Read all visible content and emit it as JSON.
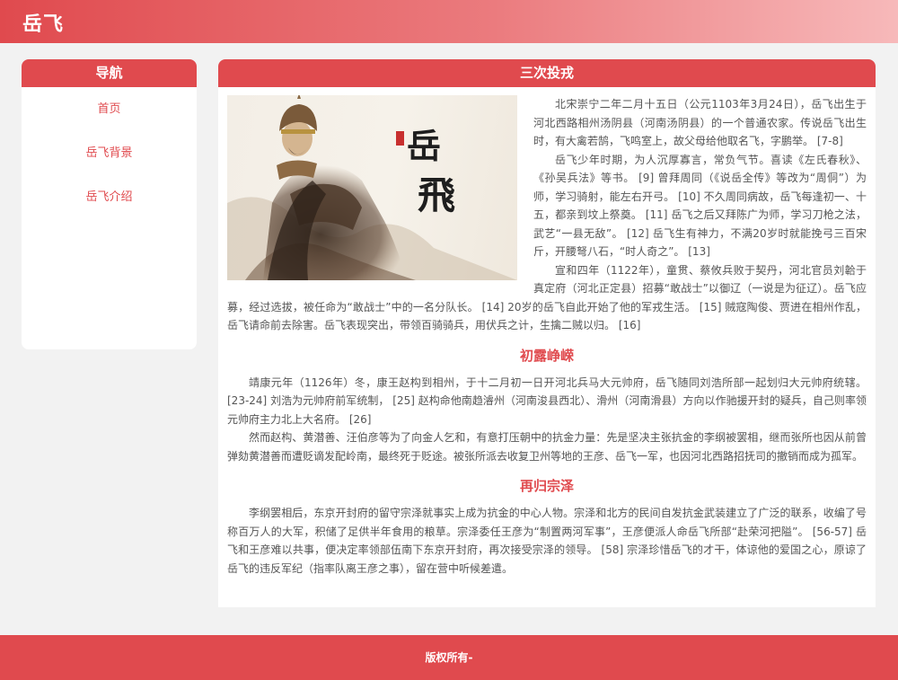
{
  "header": {
    "title": "岳飞"
  },
  "sidebar": {
    "title": "导航",
    "items": [
      {
        "label": "首页"
      },
      {
        "label": "岳飞背景"
      },
      {
        "label": "岳飞介绍"
      }
    ]
  },
  "main": {
    "title": "三次投戎",
    "image": {
      "calligraphy": "岳飛"
    },
    "intro_paragraphs": [
      "北宋崇宁二年二月十五日（公元1103年3月24日），岳飞出生于河北西路相州汤阴县（河南汤阴县）的一个普通农家。传说岳飞出生时，有大禽若鹄，飞鸣室上，故父母给他取名飞，字鹏举。 [7-8]",
      "岳飞少年时期，为人沉厚寡言，常负气节。喜读《左氏春秋》、《孙吴兵法》等书。 [9] 曾拜周同（《说岳全传》等改为“周侗”）为师，学习骑射，能左右开弓。 [10] 不久周同病故，岳飞每逢初一、十五，都亲到坟上祭奠。 [11] 岳飞之后又拜陈广为师，学习刀枪之法，武艺“一县无敌”。 [12] 岳飞生有神力，不满20岁时就能挽弓三百宋斤，开腰弩八石，“时人奇之”。 [13]",
      "宣和四年（1122年），童贯、蔡攸兵败于契丹，河北官员刘韐于真定府（河北正定县）招募“敢战士”以御辽（一说是为征辽）。岳飞应募，经过选拔，被任命为“敢战士”中的一名分队长。 [14] 20岁的岳飞自此开始了他的军戎生活。 [15] 贼寇陶俊、贾进在相州作乱，岳飞请命前去除害。岳飞表现突出，带领百骑骑兵，用伏兵之计，生擒二贼以归。 [16]"
    ],
    "sections": [
      {
        "title": "初露峥嵘",
        "paragraphs": [
          "靖康元年（1126年）冬，康王赵构到相州，于十二月初一日开河北兵马大元帅府，岳飞随同刘浩所部一起划归大元帅府统辖。 [23-24] 刘浩为元帅府前军统制， [25] 赵构命他南趋濬州（河南浚县西北）、滑州（河南滑县）方向以作驰援开封的疑兵，自己则率领元帅府主力北上大名府。 [26]",
          "然而赵构、黄潜善、汪伯彦等为了向金人乞和，有意打压朝中的抗金力量：先是坚决主张抗金的李纲被罢相，继而张所也因从前曾弹劾黄潜善而遭贬谪发配岭南，最终死于贬途。被张所派去收复卫州等地的王彦、岳飞一军，也因河北西路招抚司的撤销而成为孤军。"
        ]
      },
      {
        "title": "再归宗泽",
        "paragraphs": [
          "李纲罢相后，东京开封府的留守宗泽就事实上成为抗金的中心人物。宗泽和北方的民间自发抗金武装建立了广泛的联系，收编了号称百万人的大军，积储了足供半年食用的粮草。宗泽委任王彦为“制置两河军事”，王彦便派人命岳飞所部“赴荣河把隘”。 [56-57] 岳飞和王彦难以共事，便决定率领部伍南下东京开封府，再次接受宗泽的领导。 [58] 宗泽珍惜岳飞的才干，体谅他的爱国之心，原谅了岳飞的违反军纪（指率队离王彦之事），留在营中听候差遣。"
        ]
      }
    ]
  },
  "footer": {
    "text": "版权所有-"
  },
  "colors": {
    "accent": "#e04a4e",
    "background": "#f2f2f2",
    "text": "#555555"
  }
}
